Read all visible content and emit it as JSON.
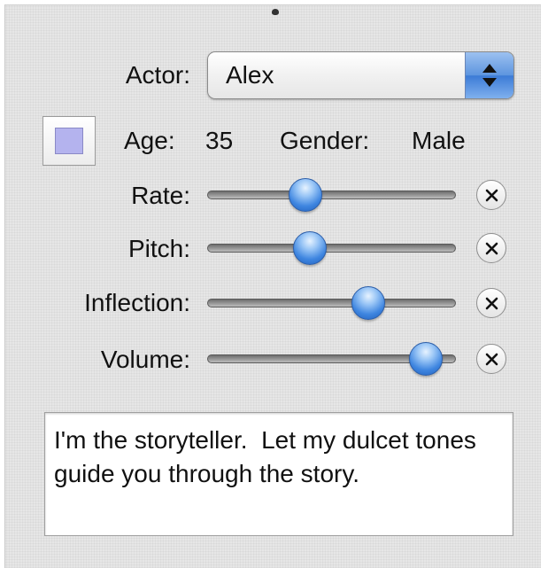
{
  "actor": {
    "label": "Actor:",
    "value": "Alex"
  },
  "info": {
    "age_label": "Age:",
    "age_value": "35",
    "gender_label": "Gender:",
    "gender_value": "Male"
  },
  "color_well": {
    "color": "#b4b3ee"
  },
  "sliders": [
    {
      "label": "Rate:",
      "value": 0.38
    },
    {
      "label": "Pitch:",
      "value": 0.4
    },
    {
      "label": "Inflection:",
      "value": 0.66
    },
    {
      "label": "Volume:",
      "value": 0.92
    }
  ],
  "text": "I'm the storyteller.  Let my dulcet tones guide you through the story."
}
